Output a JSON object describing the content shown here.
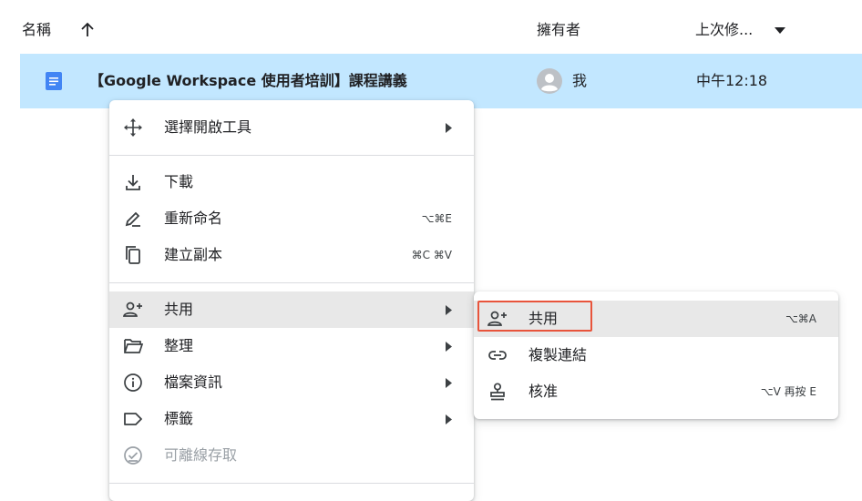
{
  "header": {
    "name_col": "名稱",
    "owner_col": "擁有者",
    "modified_col": "上次修..."
  },
  "file": {
    "name": "【Google Workspace 使用者培訓】課程講義",
    "owner": "我",
    "modified": "中午12:18",
    "icon": "google-docs-icon"
  },
  "context_menu": {
    "open_with": "選擇開啟工具",
    "download": "下載",
    "rename": "重新命名",
    "rename_shortcut": "⌥⌘E",
    "make_copy": "建立副本",
    "make_copy_shortcut": "⌘C ⌘V",
    "share": "共用",
    "organize": "整理",
    "file_info": "檔案資訊",
    "labels": "標籤",
    "offline": "可離線存取"
  },
  "share_submenu": {
    "share": "共用",
    "share_shortcut": "⌥⌘A",
    "copy_link": "複製連結",
    "approve": "核准",
    "approve_shortcut": "⌥V 再按 E"
  },
  "colors": {
    "selected_row": "#c2e7ff",
    "docs_blue": "#4285f4",
    "hover": "#e8e8e8",
    "highlight": "#e8543b"
  }
}
